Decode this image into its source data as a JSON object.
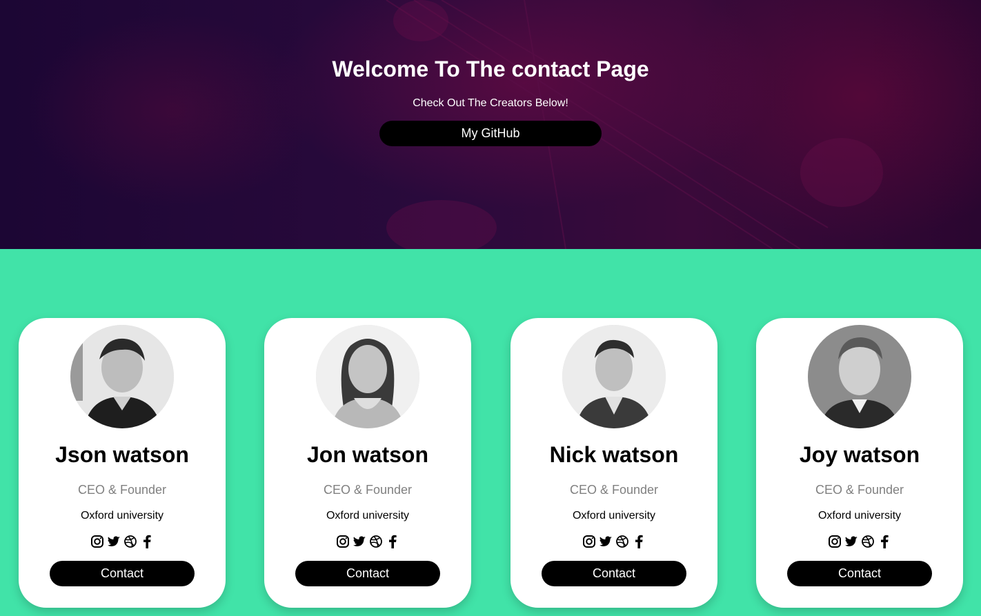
{
  "hero": {
    "title": "Welcome To The contact Page",
    "subtitle": "Check Out The Creators Below!",
    "button_label": "My GitHub"
  },
  "team": {
    "members": [
      {
        "name": "Json watson",
        "role": "CEO & Founder",
        "school": "Oxford university",
        "contact_label": "Contact"
      },
      {
        "name": "Jon watson",
        "role": "CEO & Founder",
        "school": "Oxford university",
        "contact_label": "Contact"
      },
      {
        "name": "Nick watson",
        "role": "CEO & Founder",
        "school": "Oxford university",
        "contact_label": "Contact"
      },
      {
        "name": "Joy watson",
        "role": "CEO & Founder",
        "school": "Oxford university",
        "contact_label": "Contact"
      }
    ],
    "social_icons": [
      "instagram-icon",
      "twitter-icon",
      "dribbble-icon",
      "facebook-icon"
    ]
  },
  "colors": {
    "hero_bg": "#2a0a3c",
    "team_bg": "#41e3a8",
    "card_bg": "#ffffff",
    "button_bg": "#000000",
    "role_text": "#808080"
  }
}
